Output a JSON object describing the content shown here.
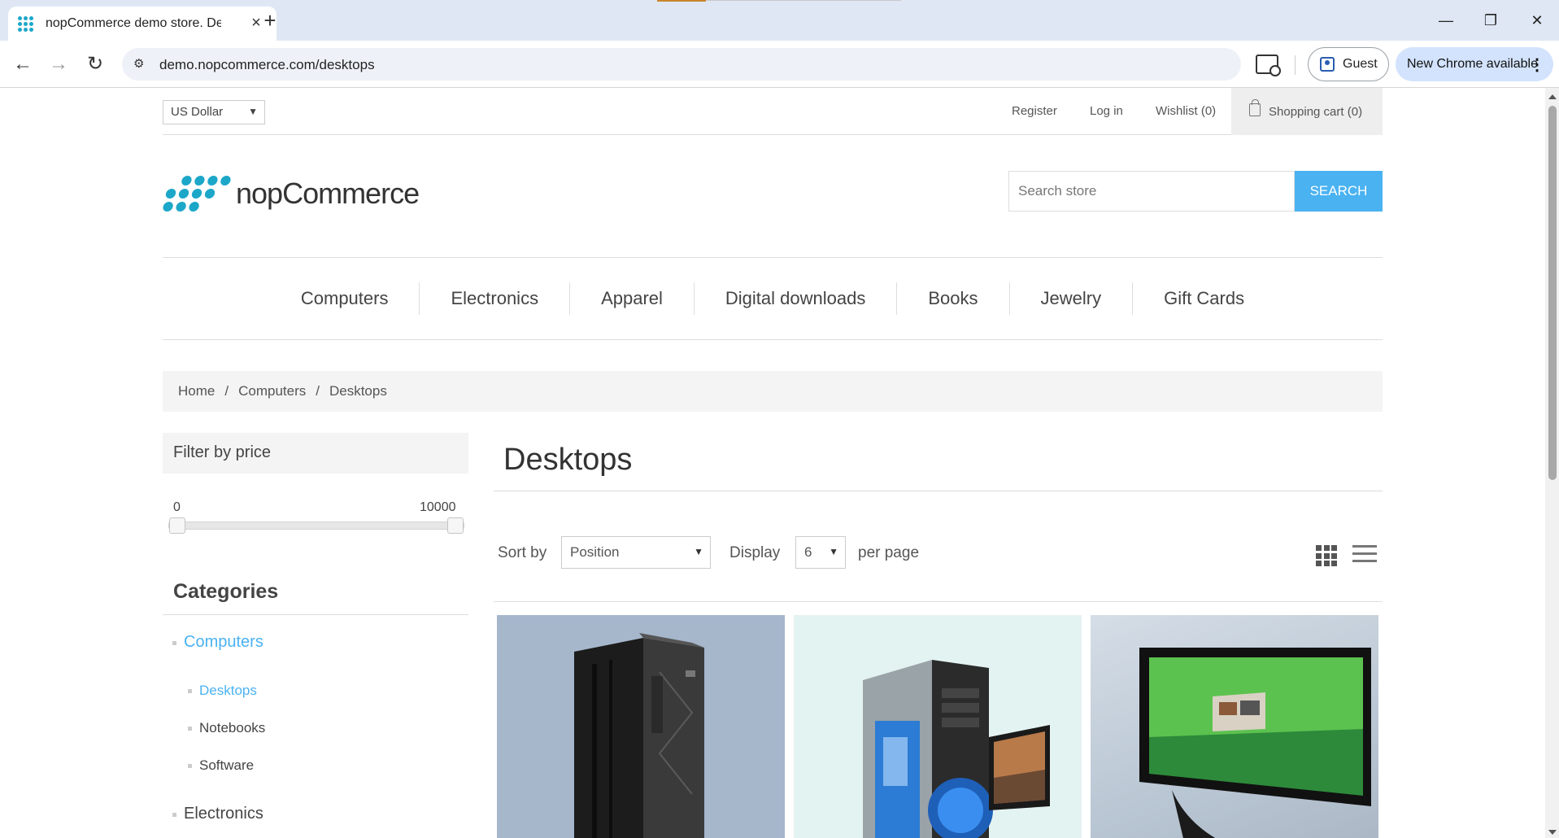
{
  "browser": {
    "tab_title": "nopCommerce demo store. Des",
    "url": "demo.nopcommerce.com/desktops",
    "profile_label": "Guest",
    "update_label": "New Chrome available"
  },
  "header": {
    "currency": "US Dollar",
    "links": {
      "register": "Register",
      "login": "Log in",
      "wishlist": "Wishlist (0)",
      "cart": "Shopping cart (0)"
    },
    "logo_text": "nopCommerce",
    "search_placeholder": "Search store",
    "search_button": "SEARCH"
  },
  "menu": [
    "Computers",
    "Electronics",
    "Apparel",
    "Digital downloads",
    "Books",
    "Jewelry",
    "Gift Cards"
  ],
  "breadcrumb": {
    "home": "Home",
    "sep": "/",
    "computers": "Computers",
    "current": "Desktops"
  },
  "sidebar": {
    "filter_title": "Filter by price",
    "price_min": "0",
    "price_max": "10000",
    "price_range_fraction": [
      0,
      1
    ],
    "categories_title": "Categories",
    "categories": {
      "computers": "Computers",
      "desktops": "Desktops",
      "notebooks": "Notebooks",
      "software": "Software",
      "electronics": "Electronics"
    }
  },
  "main": {
    "title": "Desktops",
    "sort_label": "Sort by",
    "sort_value": "Position",
    "display_label": "Display",
    "display_value": "6",
    "per_page_label": "per page"
  },
  "colors": {
    "accent": "#4ab2f1",
    "logo_blue": "#1ca7c9"
  }
}
